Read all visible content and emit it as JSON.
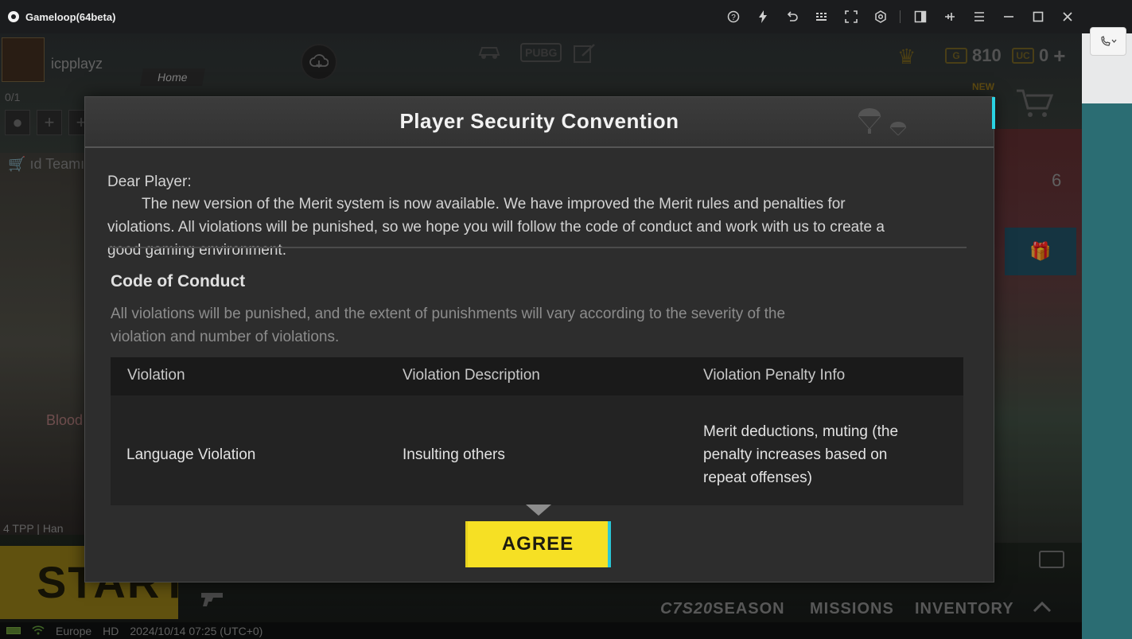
{
  "window": {
    "app_title": "Gameloop(64beta)",
    "toolbar_icons": [
      "help-icon",
      "lightning-icon",
      "undo-icon",
      "keyboard-icon",
      "fullscreen-icon",
      "settings-icon",
      "sidebar-icon",
      "pin-icon",
      "menu-icon",
      "minimize-icon",
      "maximize-icon",
      "close-icon"
    ]
  },
  "game": {
    "player_name": "icpplayz",
    "home_label": "Home",
    "squad_count": "0/1",
    "team_label": "ıd Teamı",
    "blood_label": "Blood",
    "mode_info": "4 TPP  | Han",
    "start_label": "START",
    "gold": "810",
    "uc": "0",
    "new_badge": "NEW",
    "side_counter": "6",
    "status": {
      "region": "Europe",
      "quality": "HD",
      "datetime": "2024/10/14 07:25 (UTC+0)"
    },
    "bottom_nav": {
      "season_code": "C7S20",
      "season": "SEASON",
      "missions": "MISSIONS",
      "inventory": "INVENTORY"
    }
  },
  "dialog": {
    "title": "Player Security Convention",
    "greeting": "Dear Player:",
    "intro": "The new version of the Merit system is now available. We have improved the Merit rules and penalties for violations. All violations will be punished, so we hope you will follow the code of conduct and work with us to create a good gaming environment.",
    "section_title": "Code of Conduct",
    "section_desc": "All violations will be punished, and the extent of punishments will vary according to the severity of the violation and number of violations.",
    "table": {
      "headers": [
        "Violation",
        "Violation Description",
        "Violation Penalty Info"
      ],
      "rows": [
        [
          "Language Violation",
          "Insulting others",
          "Merit deductions, muting (the penalty increases based on repeat offenses)"
        ]
      ]
    },
    "agree_label": "AGREE"
  },
  "colors": {
    "agree_button": "#f6e024",
    "agree_accent": "#2ac7d6",
    "dialog_bg": "#2d2d2d",
    "titlebar_bg": "#1b1c1e"
  }
}
